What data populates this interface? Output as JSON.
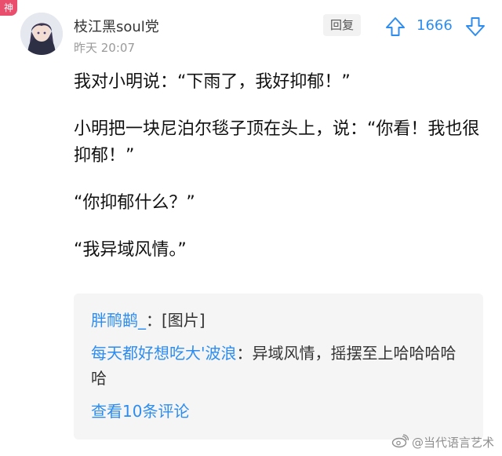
{
  "badge": {
    "label": "神",
    "color": "#e94e6d"
  },
  "post": {
    "author": "枝江黑soul党",
    "timestamp": "昨天 20:07",
    "reply_label": "回复",
    "vote_count": "1666",
    "accent_color": "#2d8cf0"
  },
  "content": {
    "paragraphs": [
      "我对小明说：“下雨了，我好抑郁！”",
      "小明把一块尼泊尔毯子顶在头上，说：“你看！我也很抑郁！”",
      "“你抑郁什么？”",
      "“我异域风情。”"
    ]
  },
  "comments": {
    "items": [
      {
        "user": "胖鸸鹋_",
        "text": "[图片]"
      },
      {
        "user": "每天都好想吃大'波浪",
        "text": "异域风情，摇摆至上哈哈哈哈哈"
      }
    ],
    "view_more": "查看10条评论"
  },
  "watermark": {
    "icon": "weibo-icon",
    "text": "@当代语言艺术"
  }
}
